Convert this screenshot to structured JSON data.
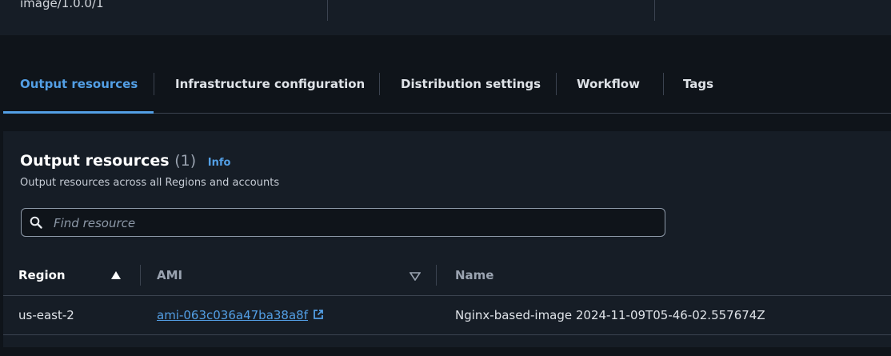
{
  "summary": {
    "image_version": "image/1.0.0/1"
  },
  "tabs": [
    {
      "label": "Output resources",
      "active": true
    },
    {
      "label": "Infrastructure configuration",
      "active": false
    },
    {
      "label": "Distribution settings",
      "active": false
    },
    {
      "label": "Workflow",
      "active": false
    },
    {
      "label": "Tags",
      "active": false
    }
  ],
  "output_resources": {
    "title": "Output resources",
    "count": "(1)",
    "info_link": "Info",
    "description": "Output resources across all Regions and accounts",
    "search": {
      "placeholder": "Find resource",
      "value": "",
      "icon": "search-icon"
    },
    "table": {
      "columns": [
        {
          "label": "Region",
          "sort": "ascending"
        },
        {
          "label": "AMI",
          "sort": "descending"
        },
        {
          "label": "Name",
          "sort": "none"
        }
      ],
      "rows": [
        {
          "region": "us-east-2",
          "ami": "ami-063c036a47ba38a8f",
          "ami_icon": "external-link-icon",
          "name": "Nginx-based-image 2024-11-09T05-46-02.557674Z"
        }
      ]
    }
  },
  "colors": {
    "background": "#0f141a",
    "panel": "#161d26",
    "accent": "#539fe5",
    "border": "#3b4350"
  }
}
